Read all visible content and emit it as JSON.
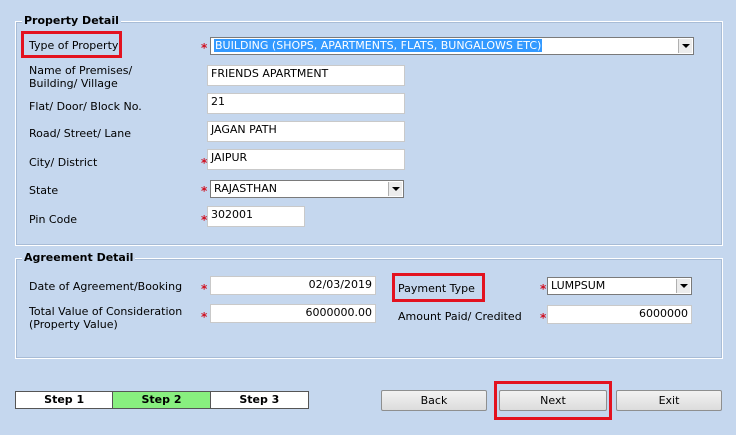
{
  "property_detail": {
    "title": "Property Detail",
    "type_of_property_label": "Type of Property",
    "type_of_property_value": "BUILDING (SHOPS, APARTMENTS, FLATS, BUNGALOWS ETC)",
    "premises_label_line1": "Name of Premises/",
    "premises_label_line2": "Building/ Village",
    "premises_value": "FRIENDS APARTMENT",
    "flat_label": "Flat/ Door/ Block No.",
    "flat_value": "21",
    "road_label": "Road/ Street/ Lane",
    "road_value": "JAGAN PATH",
    "city_label": "City/ District",
    "city_value": "JAIPUR",
    "state_label": "State",
    "state_value": "RAJASTHAN",
    "pin_label": "Pin Code",
    "pin_value": "302001"
  },
  "agreement_detail": {
    "title": "Agreement Detail",
    "date_label": "Date of Agreement/Booking",
    "date_value": "02/03/2019",
    "total_label_line1": "Total Value of Consideration",
    "total_label_line2": "(Property Value)",
    "total_value": "6000000.00",
    "payment_type_label": "Payment Type",
    "payment_type_value": "LUMPSUM",
    "amount_paid_label": "Amount Paid/ Credited",
    "amount_paid_value": "6000000"
  },
  "required_marker": "*",
  "steps": [
    "Step 1",
    "Step 2",
    "Step 3"
  ],
  "active_step": "Step 2",
  "buttons": {
    "back": "Back",
    "next": "Next",
    "exit": "Exit"
  },
  "colors": {
    "background": "#c5d7ee",
    "highlight_box": "#e3121f",
    "active_step": "#88ef7f",
    "required": "#d01020",
    "selection": "#3399ff"
  }
}
